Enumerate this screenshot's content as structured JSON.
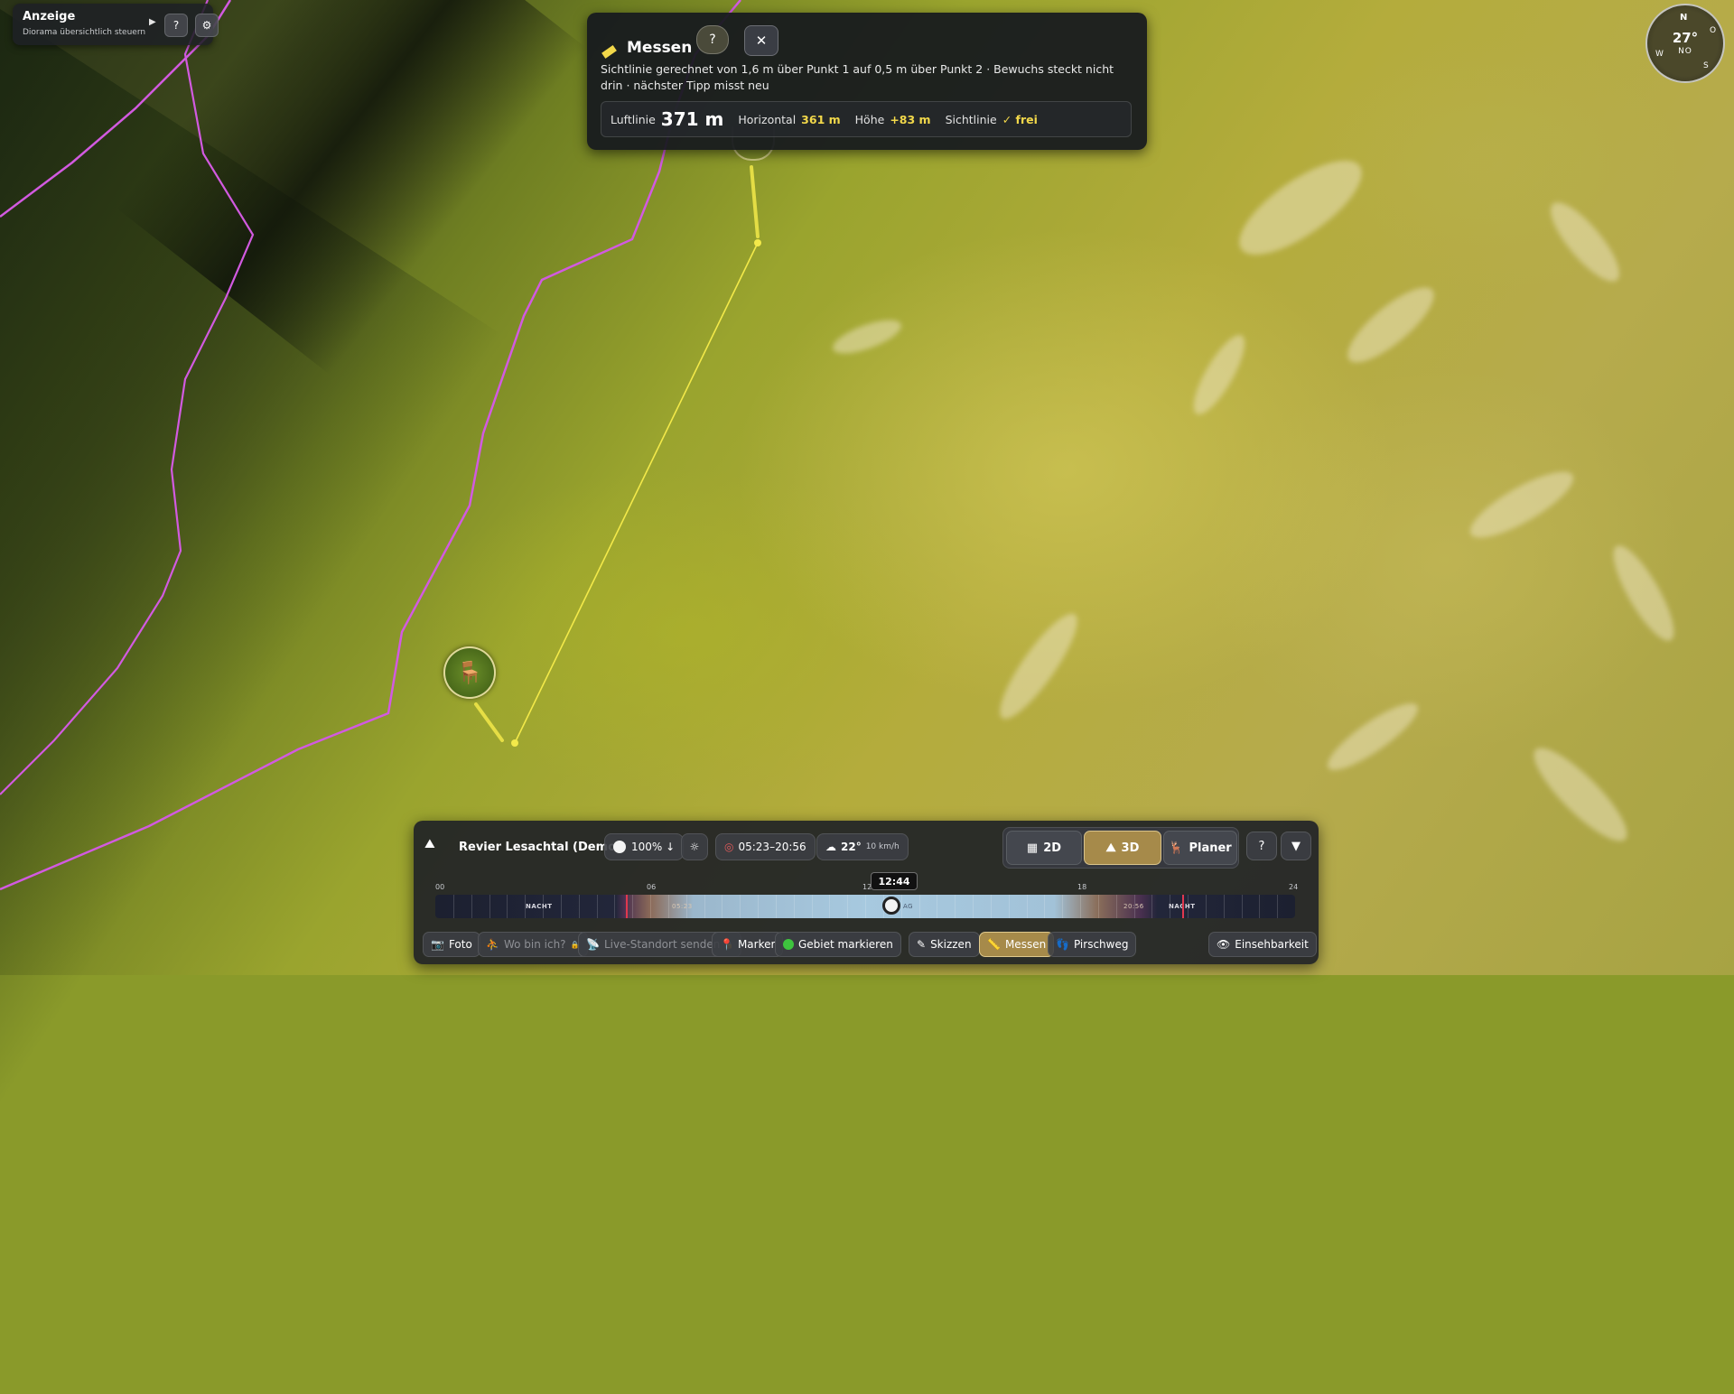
{
  "anzeige": {
    "title": "Anzeige",
    "subtitle": "Diorama übersichtlich steuern",
    "play_icon": "play-icon",
    "help_label": "?",
    "settings_icon": "gear-icon"
  },
  "messen_panel": {
    "title": "Messen",
    "help_label": "?",
    "close_label": "✕",
    "description": "Sichtlinie gerechnet von 1,6 m über Punkt 1 auf 0,5 m über Punkt 2 · Bewuchs steckt nicht drin · nächster Tipp misst neu",
    "stats": {
      "luftlinie_label": "Luftlinie",
      "luftlinie_value": "371 m",
      "horizontal_label": "Horizontal",
      "horizontal_value": "361 m",
      "hoehe_label": "Höhe",
      "hoehe_value": "+83 m",
      "sichtlinie_label": "Sichtlinie",
      "sichtlinie_value": "✓ frei"
    },
    "accent_color": "#f2d84a"
  },
  "compass": {
    "n": "N",
    "o": "O",
    "w": "W",
    "s": "S",
    "degrees": "27°",
    "direction": "NO"
  },
  "bottom_bar": {
    "revier_name": "Revier Lesachtal (Demo)",
    "moon": "100% ↓",
    "sun_times": "05:23–20:56",
    "weather_temp": "22°",
    "weather_wind": "10 km/h",
    "view_2d": "2D",
    "view_3d": "3D",
    "view_planer": "Planer",
    "help_label": "?",
    "collapse_icon": "triangle-down-icon",
    "active_view": "3D"
  },
  "timeline": {
    "hour_labels": [
      "00",
      "06",
      "12",
      "18",
      "24"
    ],
    "current_time": "12:44",
    "night_label": "NACHT",
    "sunrise_label": "05:23",
    "sunset_label": "20:56",
    "knob_day_label": "AG"
  },
  "tools": [
    {
      "label": "Foto",
      "icon": "camera-icon",
      "state": "normal"
    },
    {
      "label": "Wo bin ich?",
      "icon": "person-icon",
      "state": "disabled"
    },
    {
      "label": "Live-Standort senden",
      "icon": "broadcast-icon",
      "state": "disabled"
    },
    {
      "label": "Marker",
      "icon": "pin-icon",
      "state": "normal"
    },
    {
      "label": "Gebiet markieren",
      "icon": "green-dot-icon",
      "state": "normal"
    },
    {
      "label": "Skizzen",
      "icon": "pencil-icon",
      "state": "normal"
    },
    {
      "label": "Messen",
      "icon": "ruler-icon",
      "state": "active"
    },
    {
      "label": "Pirschweg",
      "icon": "footprint-icon",
      "state": "normal"
    },
    {
      "label": "Einsehbarkeit",
      "icon": "eye-icon",
      "state": "normal"
    }
  ],
  "colors": {
    "boundary": "#d25ae0",
    "measure_line": "#f3e94a",
    "active_tool": "#a68a4a"
  }
}
